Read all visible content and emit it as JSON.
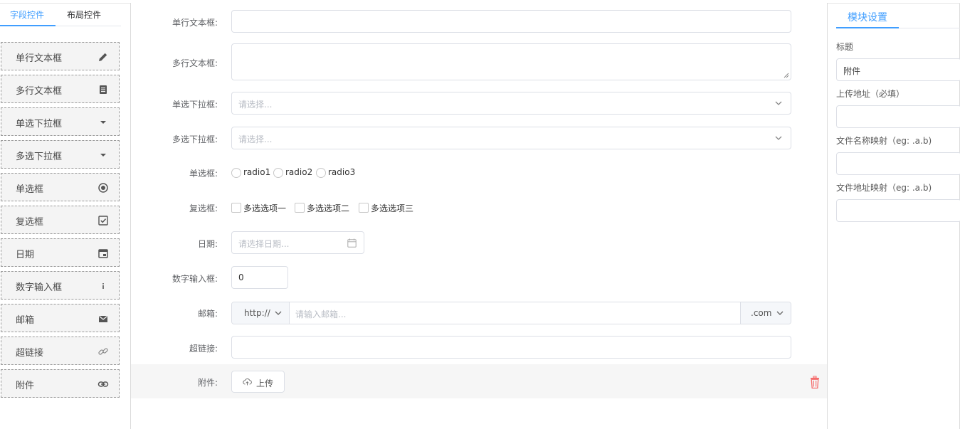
{
  "left_panel": {
    "tabs": [
      {
        "label": "字段控件",
        "active": true
      },
      {
        "label": "布局控件",
        "active": false
      }
    ],
    "controls": [
      {
        "label": "单行文本框",
        "icon": "pencil-icon"
      },
      {
        "label": "多行文本框",
        "icon": "document-icon"
      },
      {
        "label": "单选下拉框",
        "icon": "caret-down-icon"
      },
      {
        "label": "多选下拉框",
        "icon": "caret-down-icon"
      },
      {
        "label": "单选框",
        "icon": "radio-icon"
      },
      {
        "label": "复选框",
        "icon": "checkbox-icon"
      },
      {
        "label": "日期",
        "icon": "calendar-icon"
      },
      {
        "label": "数字输入框",
        "icon": "info-icon"
      },
      {
        "label": "邮箱",
        "icon": "mail-icon"
      },
      {
        "label": "超链接",
        "icon": "link-icon"
      },
      {
        "label": "附件",
        "icon": "attachment-icon"
      }
    ]
  },
  "form": {
    "single_text": {
      "label": "单行文本框:",
      "value": ""
    },
    "multi_text": {
      "label": "多行文本框:",
      "value": ""
    },
    "single_select": {
      "label": "单选下拉框:",
      "placeholder": "请选择..."
    },
    "multi_select": {
      "label": "多选下拉框:",
      "placeholder": "请选择..."
    },
    "radio": {
      "label": "单选框:",
      "options": [
        "radio1",
        "radio2",
        "radio3"
      ]
    },
    "checkbox": {
      "label": "复选框:",
      "options": [
        "多选选项一",
        "多选选项二",
        "多选选项三"
      ]
    },
    "date": {
      "label": "日期:",
      "placeholder": "请选择日期..."
    },
    "number": {
      "label": "数字输入框:",
      "value": "0"
    },
    "email": {
      "label": "邮箱:",
      "prefix": "http://",
      "placeholder": "请输入邮箱...",
      "suffix": ".com"
    },
    "hyperlink": {
      "label": "超链接:",
      "value": ""
    },
    "attachment": {
      "label": "附件:",
      "button": "上传"
    }
  },
  "right_panel": {
    "tab": "模块设置",
    "fields": [
      {
        "label": "标题",
        "value": "附件"
      },
      {
        "label": "上传地址（必填）",
        "value": ""
      },
      {
        "label": "文件名称映射（eg: .a.b)",
        "value": ""
      },
      {
        "label": "文件地址映射（eg: .a.b)",
        "value": ""
      }
    ]
  },
  "colors": {
    "accent": "#409eff",
    "delete": "#f56c6c",
    "border": "#dcdfe6",
    "placeholder": "#b8bcc4"
  }
}
